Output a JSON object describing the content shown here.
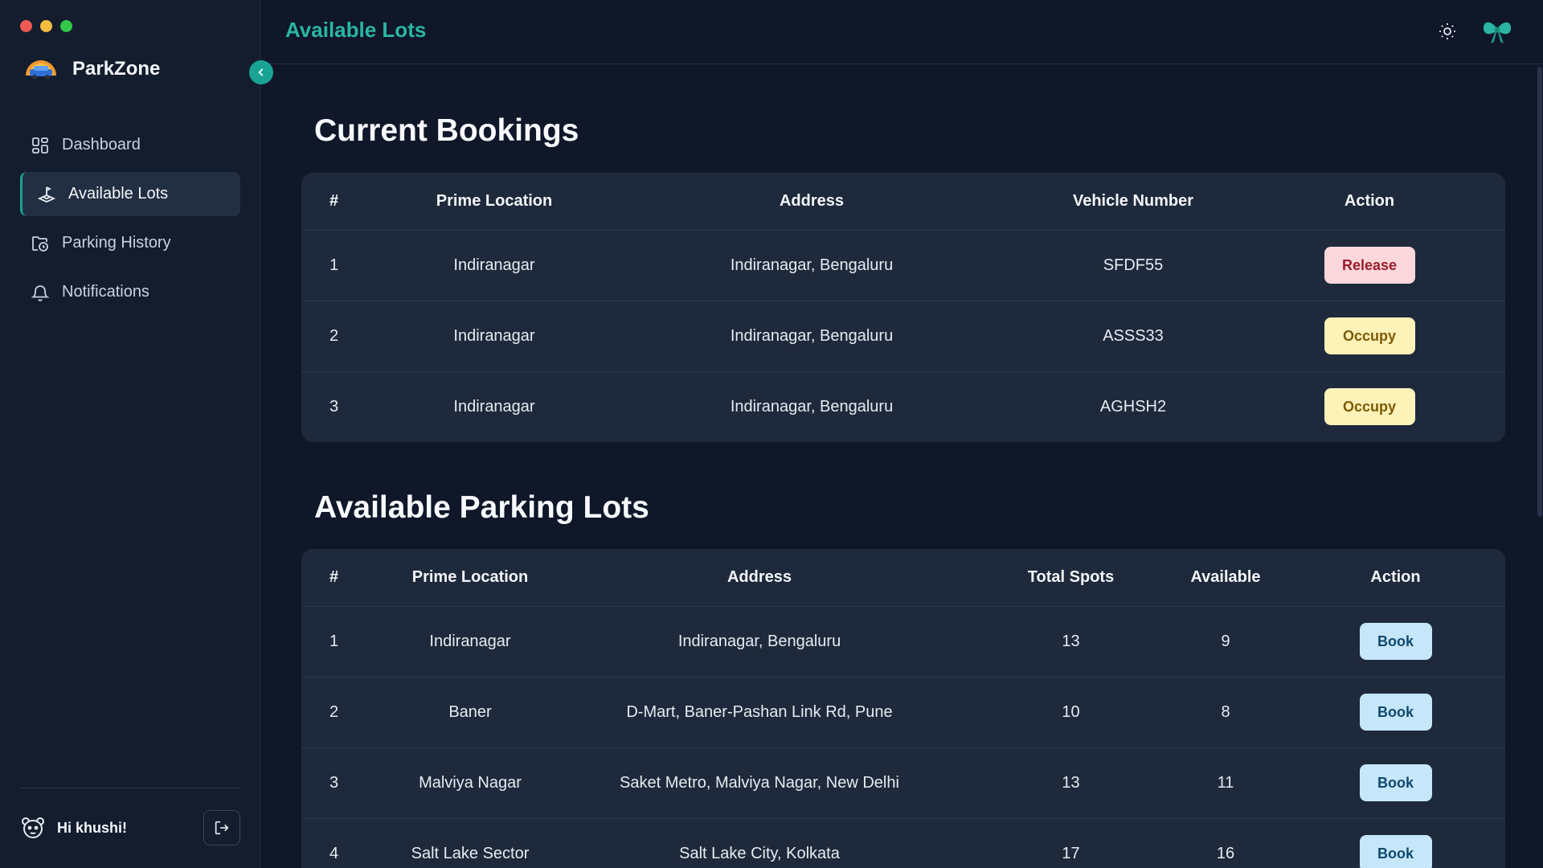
{
  "app": {
    "name": "ParkZone"
  },
  "sidebar": {
    "items": [
      {
        "label": "Dashboard",
        "icon": "dashboard-icon",
        "active": false
      },
      {
        "label": "Available Lots",
        "icon": "joystick-icon",
        "active": true
      },
      {
        "label": "Parking History",
        "icon": "folder-clock-icon",
        "active": false
      },
      {
        "label": "Notifications",
        "icon": "bell-icon",
        "active": false
      }
    ],
    "user_greeting": "Hi khushi!"
  },
  "header": {
    "title": "Available Lots"
  },
  "bookings": {
    "title": "Current Bookings",
    "columns": [
      "#",
      "Prime Location",
      "Address",
      "Vehicle Number",
      "Action"
    ],
    "rows": [
      {
        "num": "1",
        "location": "Indiranagar",
        "address": "Indiranagar, Bengaluru",
        "vehicle": "SFDF55",
        "action": "Release"
      },
      {
        "num": "2",
        "location": "Indiranagar",
        "address": "Indiranagar, Bengaluru",
        "vehicle": "ASSS33",
        "action": "Occupy"
      },
      {
        "num": "3",
        "location": "Indiranagar",
        "address": "Indiranagar, Bengaluru",
        "vehicle": "AGHSH2",
        "action": "Occupy"
      }
    ]
  },
  "lots": {
    "title": "Available Parking Lots",
    "columns": [
      "#",
      "Prime Location",
      "Address",
      "Total Spots",
      "Available",
      "Action"
    ],
    "rows": [
      {
        "num": "1",
        "location": "Indiranagar",
        "address": "Indiranagar, Bengaluru",
        "total": "13",
        "available": "9",
        "action": "Book"
      },
      {
        "num": "2",
        "location": "Baner",
        "address": "D-Mart, Baner-Pashan Link Rd, Pune",
        "total": "10",
        "available": "8",
        "action": "Book"
      },
      {
        "num": "3",
        "location": "Malviya Nagar",
        "address": "Saket Metro, Malviya Nagar, New Delhi",
        "total": "13",
        "available": "11",
        "action": "Book"
      },
      {
        "num": "4",
        "location": "Salt Lake Sector",
        "address": "Salt Lake City, Kolkata",
        "total": "17",
        "available": "16",
        "action": "Book"
      }
    ]
  },
  "colors": {
    "accent": "#19a394",
    "release": "#fcd8dc",
    "occupy": "#fdf2b8",
    "book": "#c6e6fa"
  }
}
